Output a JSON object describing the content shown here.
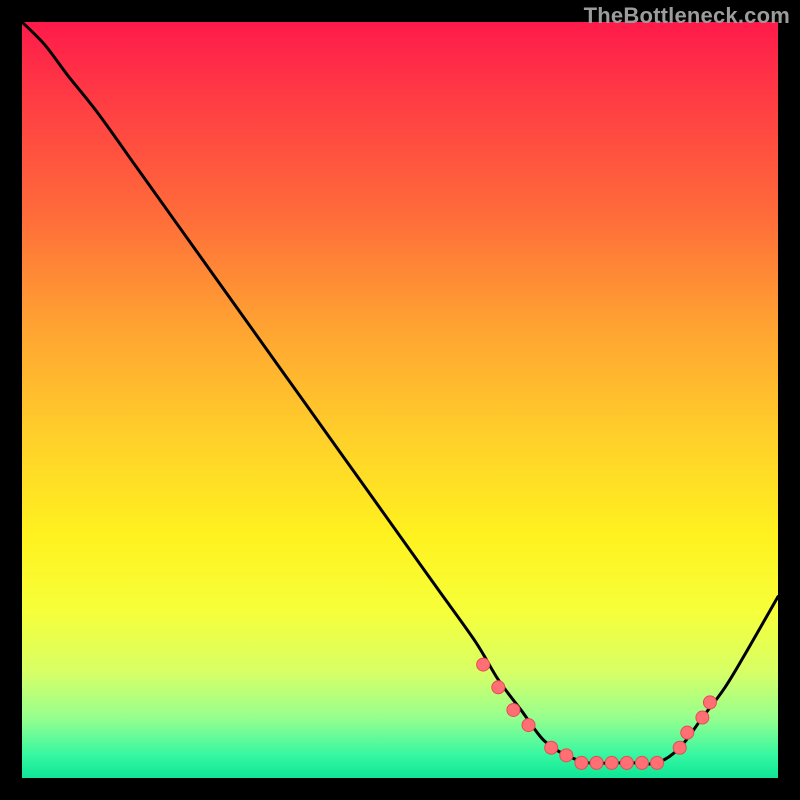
{
  "watermark": "TheBottleneck.com",
  "colors": {
    "background": "#000000",
    "gradient_stops": [
      {
        "offset": 0.0,
        "color": "#ff1a4b"
      },
      {
        "offset": 0.1,
        "color": "#ff3b44"
      },
      {
        "offset": 0.25,
        "color": "#ff6a3a"
      },
      {
        "offset": 0.4,
        "color": "#ffa232"
      },
      {
        "offset": 0.55,
        "color": "#ffd02a"
      },
      {
        "offset": 0.68,
        "color": "#fff21f"
      },
      {
        "offset": 0.78,
        "color": "#f6ff3a"
      },
      {
        "offset": 0.86,
        "color": "#d7ff66"
      },
      {
        "offset": 0.92,
        "color": "#97ff8e"
      },
      {
        "offset": 0.97,
        "color": "#35f7a1"
      },
      {
        "offset": 1.0,
        "color": "#0ee696"
      }
    ],
    "curve": "#000000",
    "marker_fill": "#ff6f74",
    "marker_stroke": "#e84b54"
  },
  "chart_data": {
    "type": "line",
    "title": "",
    "xlabel": "",
    "ylabel": "",
    "xlim": [
      0,
      100
    ],
    "ylim": [
      0,
      100
    ],
    "series": [
      {
        "name": "bottleneck-curve",
        "x": [
          0,
          3,
          6,
          10,
          15,
          20,
          25,
          30,
          35,
          40,
          45,
          50,
          55,
          60,
          63,
          66,
          69,
          72,
          75,
          78,
          81,
          84,
          87,
          90,
          93,
          96,
          100
        ],
        "y": [
          100,
          97,
          93,
          88,
          81,
          74,
          67,
          60,
          53,
          46,
          39,
          32,
          25,
          18,
          13,
          9,
          5,
          3,
          2,
          2,
          2,
          2,
          4,
          8,
          12,
          17,
          24
        ]
      }
    ],
    "markers": {
      "name": "highlight-points",
      "x": [
        61,
        63,
        65,
        67,
        70,
        72,
        74,
        76,
        78,
        80,
        82,
        84,
        87,
        88,
        90,
        91
      ],
      "y": [
        15,
        12,
        9,
        7,
        4,
        3,
        2,
        2,
        2,
        2,
        2,
        2,
        4,
        6,
        8,
        10
      ]
    }
  }
}
